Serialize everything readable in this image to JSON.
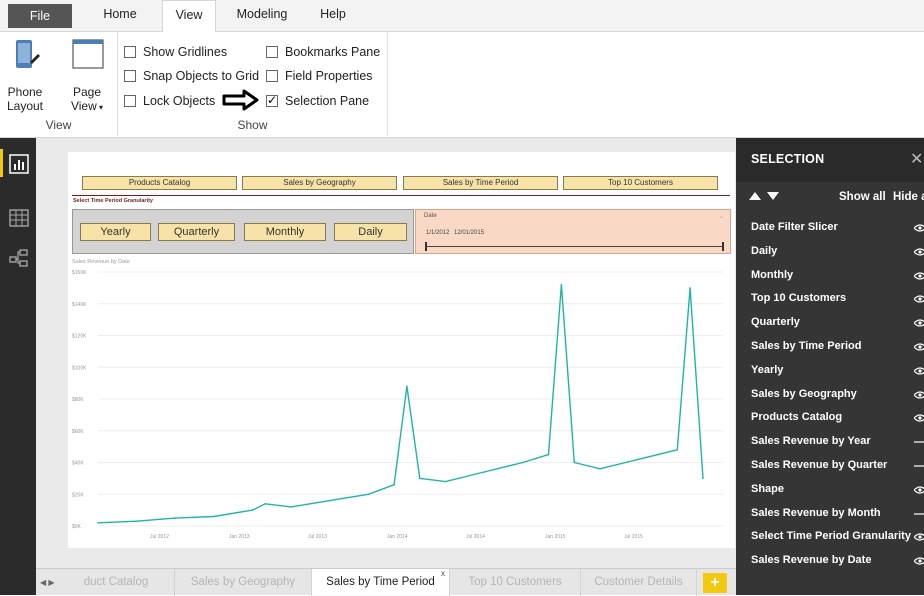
{
  "ribbon": {
    "tabs": [
      "File",
      "Home",
      "View",
      "Modeling",
      "Help"
    ],
    "active_tab": "View",
    "view_group": {
      "label": "View",
      "phone_layout": "Phone\nLayout",
      "page_view": "Page\nView"
    },
    "show_group": {
      "label": "Show",
      "checkboxes": [
        {
          "label": "Show Gridlines",
          "checked": false
        },
        {
          "label": "Snap Objects to Grid",
          "checked": false
        },
        {
          "label": "Lock Objects",
          "checked": false
        },
        {
          "label": "Bookmarks Pane",
          "checked": false
        },
        {
          "label": "Field Properties",
          "checked": false
        },
        {
          "label": "Selection Pane",
          "checked": true
        }
      ]
    }
  },
  "report": {
    "nav_buttons": [
      "Products Catalog",
      "Sales by Geography",
      "Sales by Time Period",
      "Top 10 Customers"
    ],
    "granularity_title": "Select Time Period Granularity",
    "granularity_buttons": [
      "Yearly",
      "Quarterly",
      "Monthly",
      "Daily"
    ],
    "date_slicer": {
      "label": "Date",
      "start": "1/1/2012",
      "end": "12/01/2015"
    },
    "chart_title": "Sales Revenue by Date"
  },
  "chart_data": {
    "type": "line",
    "title": "Sales Revenue by Date",
    "ylim": [
      0,
      160
    ],
    "y_unit": "K",
    "y_ticks": [
      "$0K",
      "$20K",
      "$40K",
      "$60K",
      "$80K",
      "$100K",
      "$120K",
      "$140K",
      "$160K"
    ],
    "x_ticks": [
      "Jul 2012",
      "Jan 2013",
      "Jul 2013",
      "Jan 2014",
      "Jul 2014",
      "Jan 2015",
      "Jul 2015"
    ],
    "color": "#1fb4aa",
    "x": [
      "2012-01",
      "2012-04",
      "2012-07",
      "2012-10",
      "2013-01",
      "2013-02",
      "2013-04",
      "2013-07",
      "2013-10",
      "2013-12",
      "2014-01",
      "2014-02",
      "2014-04",
      "2014-07",
      "2014-10",
      "2014-12",
      "2015-01",
      "2015-02",
      "2015-04",
      "2015-07",
      "2015-10",
      "2015-11",
      "2015-12"
    ],
    "values": [
      2,
      3,
      5,
      6,
      10,
      14,
      12,
      16,
      20,
      26,
      88,
      30,
      28,
      34,
      40,
      45,
      152,
      40,
      36,
      42,
      48,
      150,
      30
    ]
  },
  "page_tabs": [
    {
      "label": "duct Catalog",
      "active": false
    },
    {
      "label": "Sales by Geography",
      "active": false
    },
    {
      "label": "Sales by Time Period",
      "active": true
    },
    {
      "label": "Top 10 Customers",
      "active": false
    },
    {
      "label": "Customer Details",
      "active": false
    }
  ],
  "add_tab": "+",
  "tab_close": "x",
  "selection_pane": {
    "title": "SELECTION",
    "show_all": "Show all",
    "hide_all": "Hide a",
    "items": [
      {
        "label": "Date Filter Slicer",
        "visible": true
      },
      {
        "label": "Daily",
        "visible": true
      },
      {
        "label": "Monthly",
        "visible": true
      },
      {
        "label": "Top 10 Customers",
        "visible": true
      },
      {
        "label": "Quarterly",
        "visible": true
      },
      {
        "label": "Sales by Time Period",
        "visible": true
      },
      {
        "label": "Yearly",
        "visible": true
      },
      {
        "label": "Sales by Geography",
        "visible": true
      },
      {
        "label": "Products Catalog",
        "visible": true
      },
      {
        "label": "Sales Revenue by Year",
        "visible": false
      },
      {
        "label": "Sales Revenue by Quarter",
        "visible": false
      },
      {
        "label": "Shape",
        "visible": true
      },
      {
        "label": "Sales Revenue by Month",
        "visible": false
      },
      {
        "label": "Select Time Period Granularity",
        "visible": true
      },
      {
        "label": "Sales Revenue by Date",
        "visible": true
      }
    ]
  }
}
